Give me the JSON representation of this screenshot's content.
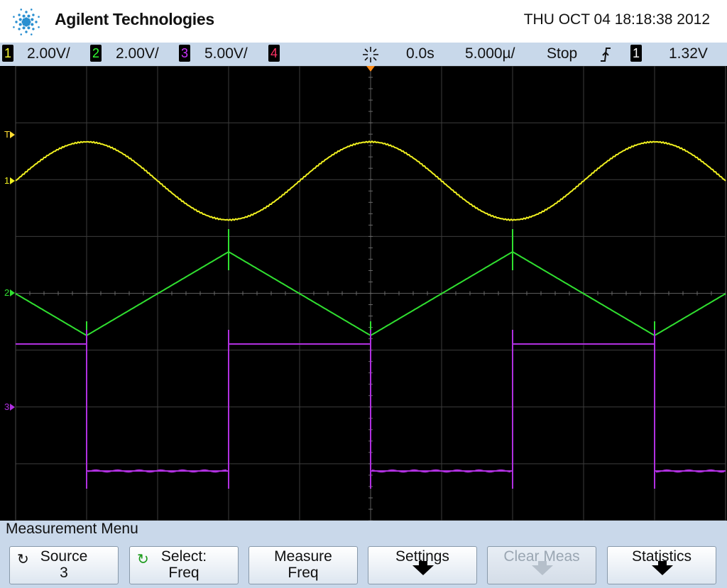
{
  "header": {
    "brand": "Agilent Technologies",
    "datetime": "THU OCT 04 18:18:38 2012"
  },
  "status": {
    "channels": [
      {
        "num": "1",
        "scale": "2.00V/",
        "color": "#ffff33"
      },
      {
        "num": "2",
        "scale": "2.00V/",
        "color": "#33ff33"
      },
      {
        "num": "3",
        "scale": "5.00V/",
        "color": "#cc33ff"
      },
      {
        "num": "4",
        "scale": "",
        "color": "#ff3366"
      }
    ],
    "trigger_icon": "trigger-star-icon",
    "delay": "0.0s",
    "timebase": "5.000µ/",
    "run_state": "Stop",
    "edge_icon": "rising-edge-icon",
    "trigger_source": "1",
    "trigger_level": "1.32V"
  },
  "screen": {
    "markers": {
      "trigger": "T",
      "ch1": "1",
      "ch2": "2",
      "ch3": "3"
    },
    "trace_colors": {
      "ch1": "#f0f020",
      "ch2": "#30e030",
      "ch3": "#b030e0"
    }
  },
  "menu": {
    "title": "Measurement Menu",
    "softkeys": [
      {
        "line1": "Source",
        "line2": "3",
        "icon": "rotate-knob-icon"
      },
      {
        "line1": "Select:",
        "line2": "Freq",
        "icon": "rotate-knob-green-icon"
      },
      {
        "line1": "Measure",
        "line2": "Freq"
      },
      {
        "line1": "Settings",
        "line2": ""
      },
      {
        "line1": "Clear Meas",
        "line2": ""
      },
      {
        "line1": "Statistics",
        "line2": ""
      }
    ]
  }
}
